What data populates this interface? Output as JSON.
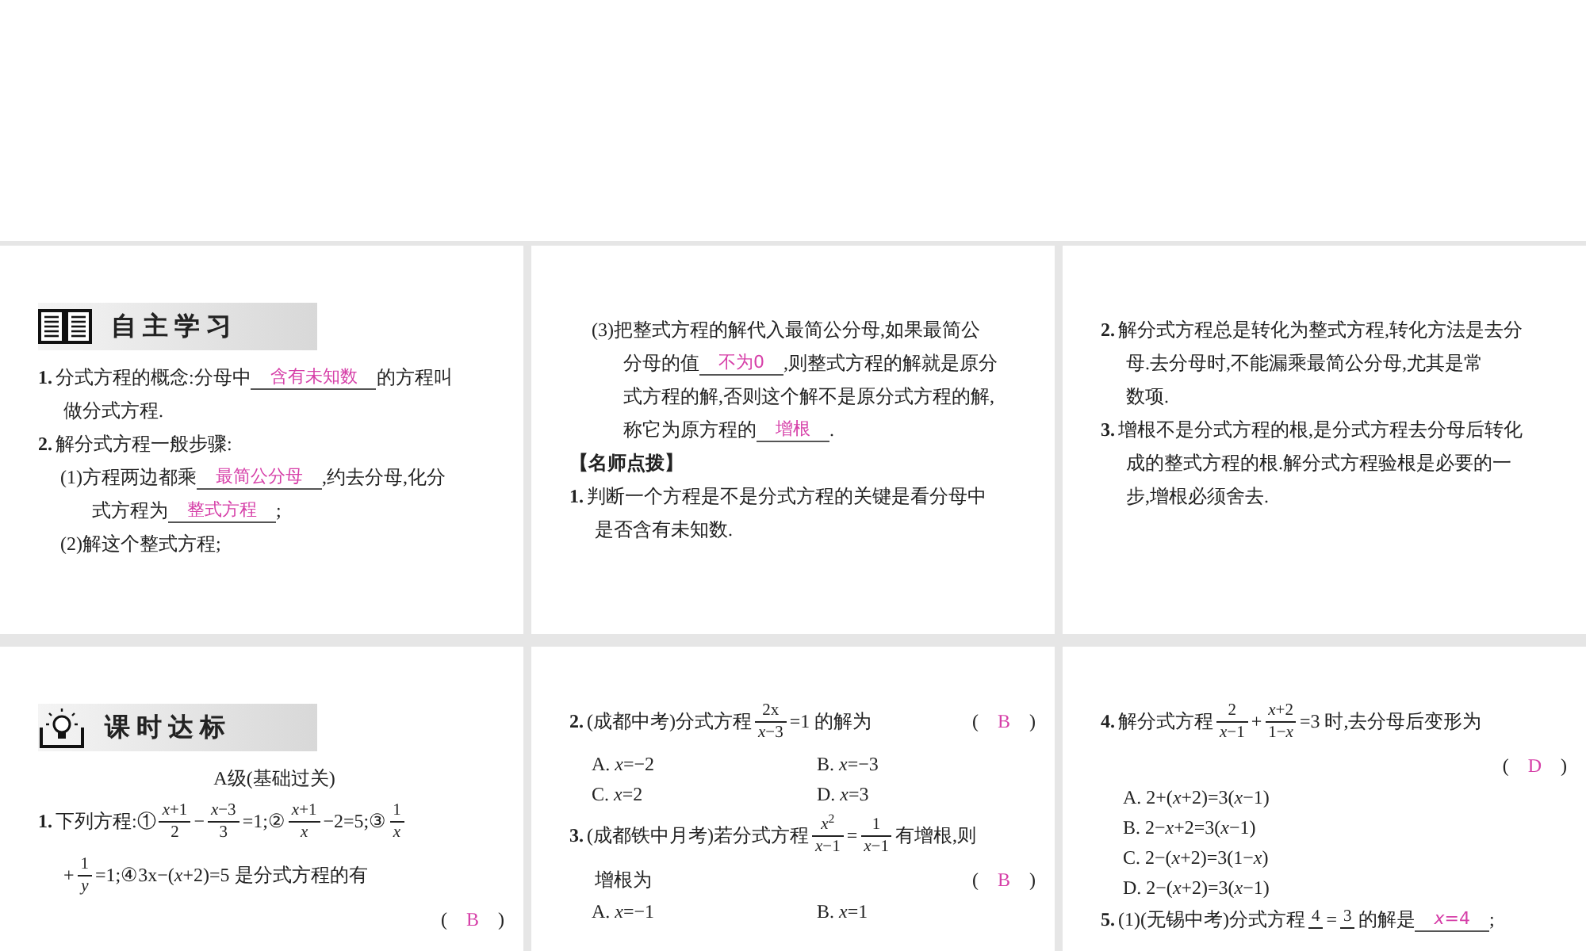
{
  "slides": [
    {
      "heading": {
        "title": "自主学习"
      },
      "lines": [
        {
          "kind": "item",
          "parts": [
            {
              "kind": "number",
              "text": "1."
            },
            {
              "kind": "text",
              "text": "分式方程的概念:分母中"
            },
            {
              "kind": "answer",
              "text": "含有未知数"
            },
            {
              "kind": "text",
              "text": "的方程叫"
            }
          ]
        },
        {
          "kind": "cont",
          "parts": [
            {
              "kind": "text",
              "text": "做分式方程."
            }
          ]
        },
        {
          "kind": "item",
          "parts": [
            {
              "kind": "number",
              "text": "2."
            },
            {
              "kind": "text",
              "text": "解分式方程一般步骤:"
            }
          ]
        },
        {
          "kind": "sub",
          "parts": [
            {
              "kind": "text",
              "text": "(1)方程两边都乘"
            },
            {
              "kind": "answer",
              "text": "最简公分母"
            },
            {
              "kind": "text",
              "text": ",约去分母,化分"
            }
          ]
        },
        {
          "kind": "subcont",
          "parts": [
            {
              "kind": "text",
              "text": "式方程为"
            },
            {
              "kind": "answer",
              "text": "整式方程"
            },
            {
              "kind": "text",
              "text": ";"
            }
          ]
        },
        {
          "kind": "sub",
          "parts": [
            {
              "kind": "text",
              "text": "(2)解这个整式方程;"
            }
          ]
        }
      ]
    },
    {
      "lines": [
        {
          "kind": "sub",
          "parts": [
            {
              "kind": "text",
              "text": "(3)把整式方程的解代入最简公分母,如果最简公"
            }
          ]
        },
        {
          "kind": "subcont",
          "parts": [
            {
              "kind": "text",
              "text": "分母的值"
            },
            {
              "kind": "answer",
              "text": "不为0"
            },
            {
              "kind": "text",
              "text": ",则整式方程的解就是原分"
            }
          ]
        },
        {
          "kind": "subcont",
          "parts": [
            {
              "kind": "text",
              "text": "式方程的解,否则这个解不是原分式方程的解,"
            }
          ]
        },
        {
          "kind": "subcont",
          "parts": [
            {
              "kind": "text",
              "text": "称它为原方程的"
            },
            {
              "kind": "answer",
              "text": "增根"
            },
            {
              "kind": "text",
              "text": "."
            }
          ]
        },
        {
          "kind": "item",
          "parts": [
            {
              "kind": "bold",
              "text": "【名师点拨】"
            }
          ]
        },
        {
          "kind": "item",
          "parts": [
            {
              "kind": "number",
              "text": "1."
            },
            {
              "kind": "text",
              "text": "判断一个方程是不是分式方程的关键是看分母中"
            }
          ]
        },
        {
          "kind": "cont",
          "parts": [
            {
              "kind": "text",
              "text": "是否含有未知数."
            }
          ]
        }
      ]
    },
    {
      "lines": [
        {
          "kind": "item",
          "parts": [
            {
              "kind": "number",
              "text": "2."
            },
            {
              "kind": "text",
              "text": "解分式方程总是转化为整式方程,转化方法是去分"
            }
          ]
        },
        {
          "kind": "cont",
          "parts": [
            {
              "kind": "text",
              "text": "母.去分母时,不能漏乘最简公分母,尤其是常"
            }
          ]
        },
        {
          "kind": "cont",
          "parts": [
            {
              "kind": "text",
              "text": "数项."
            }
          ]
        },
        {
          "kind": "item",
          "parts": [
            {
              "kind": "number",
              "text": "3."
            },
            {
              "kind": "text",
              "text": "增根不是分式方程的根,是分式方程去分母后转化"
            }
          ]
        },
        {
          "kind": "cont",
          "parts": [
            {
              "kind": "text",
              "text": "成的整式方程的根.解分式方程验根是必要的一"
            }
          ]
        },
        {
          "kind": "cont",
          "parts": [
            {
              "kind": "text",
              "text": "步,增根必须舍去."
            }
          ]
        }
      ]
    },
    {
      "heading": {
        "title": "课时达标"
      },
      "lines": [
        {
          "kind": "center",
          "parts": [
            {
              "kind": "text",
              "text": "A级(基础过关)"
            }
          ]
        },
        {
          "kind": "item",
          "parts": [
            {
              "kind": "number",
              "text": "1."
            },
            {
              "kind": "text",
              "text": "下列方程:①"
            },
            {
              "kind": "frac",
              "num": "*x*+1",
              "den": "2"
            },
            {
              "kind": "text",
              "text": "−"
            },
            {
              "kind": "frac",
              "num": "*x*−3",
              "den": "3"
            },
            {
              "kind": "text",
              "text": "=1;②"
            },
            {
              "kind": "frac",
              "num": "*x*+1",
              "den": "*x*"
            },
            {
              "kind": "text",
              "text": "−2=5;③"
            },
            {
              "kind": "frac",
              "num": "1",
              "den": "*x*"
            }
          ]
        },
        {
          "kind": "cont",
          "parts": [
            {
              "kind": "text",
              "text": "+"
            },
            {
              "kind": "frac",
              "num": "1",
              "den": "*y*"
            },
            {
              "kind": "text",
              "text": "=1;④3x−(*x*+2)=5 是分式方程的有"
            }
          ]
        },
        {
          "kind": "right",
          "parts": [
            {
              "kind": "text",
              "text": "("
            },
            {
              "kind": "choice",
              "text": "B"
            },
            {
              "kind": "text",
              "text": ")"
            }
          ]
        }
      ]
    },
    {
      "lines": [
        {
          "kind": "item",
          "parts": [
            {
              "kind": "number",
              "text": "2."
            },
            {
              "kind": "text",
              "text": "(成都中考)分式方程"
            },
            {
              "kind": "frac",
              "num": "2x",
              "den": "*x*−3"
            },
            {
              "kind": "text",
              "text": "=1 的解为"
            }
          ],
          "tail": [
            {
              "kind": "text",
              "text": "("
            },
            {
              "kind": "choice",
              "text": "B"
            },
            {
              "kind": "text",
              "text": ")"
            }
          ]
        },
        {
          "kind": "options",
          "options": [
            "A. *x*=−2",
            "B. *x*=−3"
          ]
        },
        {
          "kind": "options",
          "options": [
            "C. *x*=2",
            "D. *x*=3"
          ]
        },
        {
          "kind": "item",
          "parts": [
            {
              "kind": "number",
              "text": "3."
            },
            {
              "kind": "text",
              "text": "(成都铁中月考)若分式方程"
            },
            {
              "kind": "frac",
              "num": "*x*$^{2}$",
              "den": "*x*−1"
            },
            {
              "kind": "text",
              "text": "="
            },
            {
              "kind": "frac",
              "num": "1",
              "den": "*x*−1"
            },
            {
              "kind": "text",
              "text": "有增根,则"
            }
          ]
        },
        {
          "kind": "cont",
          "parts": [
            {
              "kind": "text",
              "text": "增根为"
            }
          ],
          "tail": [
            {
              "kind": "text",
              "text": "("
            },
            {
              "kind": "choice",
              "text": "B"
            },
            {
              "kind": "text",
              "text": ")"
            }
          ]
        },
        {
          "kind": "options",
          "options": [
            "A. *x*=−1",
            "B. *x*=1"
          ]
        }
      ]
    },
    {
      "lines": [
        {
          "kind": "item",
          "parts": [
            {
              "kind": "number",
              "text": "4."
            },
            {
              "kind": "text",
              "text": "解分式方程"
            },
            {
              "kind": "frac",
              "num": "2",
              "den": "*x*−1"
            },
            {
              "kind": "text",
              "text": "+"
            },
            {
              "kind": "frac",
              "num": "*x*+2",
              "den": "1−*x*"
            },
            {
              "kind": "text",
              "text": "=3 时,去分母后变形为"
            }
          ]
        },
        {
          "kind": "right",
          "parts": [
            {
              "kind": "text",
              "text": "("
            },
            {
              "kind": "choice",
              "text": "D"
            },
            {
              "kind": "text",
              "text": ")"
            }
          ]
        },
        {
          "kind": "options",
          "options": [
            "A. 2+(*x*+2)=3(*x*−1)"
          ]
        },
        {
          "kind": "options",
          "options": [
            "B. 2−*x*+2=3(*x*−1)"
          ]
        },
        {
          "kind": "options",
          "options": [
            "C. 2−(*x*+2)=3(1−*x*)"
          ]
        },
        {
          "kind": "options",
          "options": [
            "D. 2−(*x*+2)=3(*x*−1)"
          ]
        },
        {
          "kind": "item",
          "parts": [
            {
              "kind": "number",
              "text": "5."
            },
            {
              "kind": "text",
              "text": "(1)(无锡中考)分式方程"
            },
            {
              "kind": "frac",
              "num": "4"
            },
            {
              "kind": "text",
              "text": "="
            },
            {
              "kind": "frac",
              "num": "3"
            },
            {
              "kind": "text",
              "text": "的解是"
            },
            {
              "kind": "answer",
              "text": "*x*=4"
            },
            {
              "kind": "text",
              "text": ";"
            }
          ]
        }
      ]
    }
  ]
}
